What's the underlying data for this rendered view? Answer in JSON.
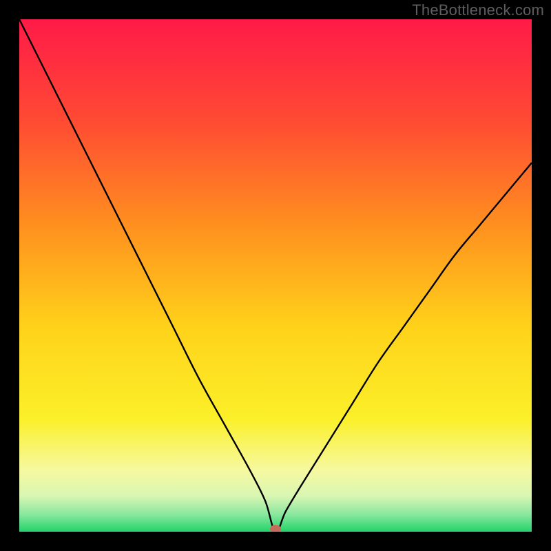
{
  "watermark": "TheBottleneck.com",
  "chart_data": {
    "type": "line",
    "title": "",
    "xlabel": "",
    "ylabel": "",
    "xlim": [
      0,
      100
    ],
    "ylim": [
      0,
      100
    ],
    "x": [
      0,
      5,
      10,
      15,
      20,
      25,
      30,
      35,
      40,
      45,
      48,
      50,
      52,
      55,
      60,
      65,
      70,
      75,
      80,
      85,
      90,
      95,
      100
    ],
    "values": [
      100,
      90,
      80,
      70,
      60,
      50,
      40,
      30,
      21,
      12,
      6,
      0,
      4,
      9,
      17,
      25,
      33,
      40,
      47,
      54,
      60,
      66,
      72
    ],
    "marker": {
      "x": 50,
      "y": 0
    },
    "gradient_stops": [
      {
        "offset": 0.0,
        "color": "#ff1a48"
      },
      {
        "offset": 0.2,
        "color": "#ff4b33"
      },
      {
        "offset": 0.4,
        "color": "#ff8f1f"
      },
      {
        "offset": 0.6,
        "color": "#ffd21a"
      },
      {
        "offset": 0.78,
        "color": "#fbf029"
      },
      {
        "offset": 0.88,
        "color": "#f6f9a0"
      },
      {
        "offset": 0.93,
        "color": "#d9f6b3"
      },
      {
        "offset": 0.965,
        "color": "#8de8a0"
      },
      {
        "offset": 1.0,
        "color": "#23d36b"
      }
    ],
    "marker_color": "#c76b5b",
    "curve_color": "#000000"
  }
}
